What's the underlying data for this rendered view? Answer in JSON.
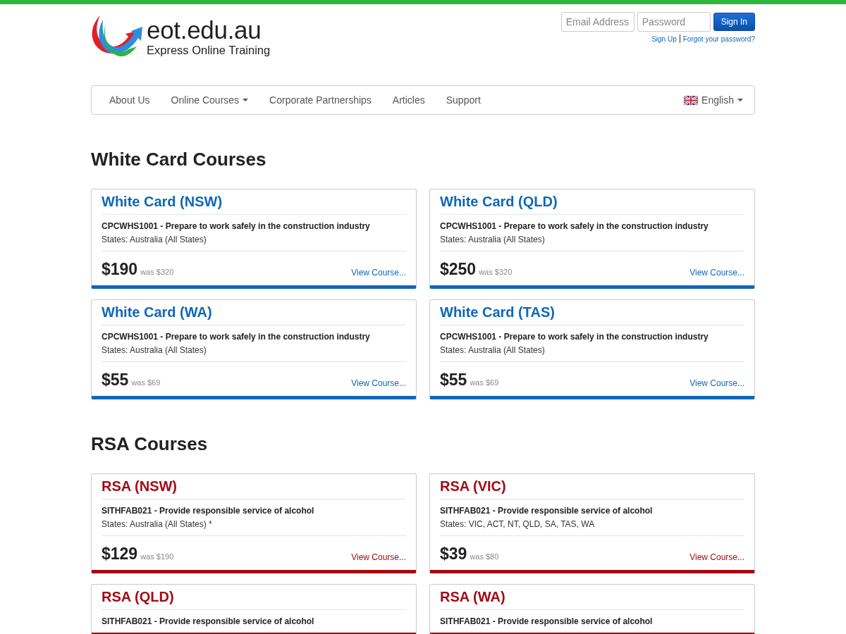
{
  "logo": {
    "name": "eot.edu.au",
    "tagline": "Express Online Training"
  },
  "login": {
    "email_placeholder": "Email Address",
    "password_placeholder": "Password",
    "button": "Sign In",
    "links": [
      "Sign Up",
      "Forgot your password?"
    ]
  },
  "nav": {
    "items": [
      {
        "label": "About Us",
        "dropdown": false
      },
      {
        "label": "Online Courses",
        "dropdown": true
      },
      {
        "label": "Corporate Partnerships",
        "dropdown": false
      },
      {
        "label": "Articles",
        "dropdown": false
      },
      {
        "label": "Support",
        "dropdown": false
      }
    ],
    "language": "English"
  },
  "sections": [
    {
      "title": "White Card Courses",
      "color": "#0f68b8",
      "courses": [
        {
          "title": "White Card (NSW)",
          "unit": "CPCWHS1001 - Prepare to work safely in the construction industry",
          "states": "States: Australia (All States)",
          "price": "$190",
          "was": "was $320",
          "link": "View Course..."
        },
        {
          "title": "White Card (QLD)",
          "unit": "CPCWHS1001 - Prepare to work safely in the construction industry",
          "states": "States: Australia (All States)",
          "price": "$250",
          "was": "was $320",
          "link": "View Course..."
        },
        {
          "title": "White Card (WA)",
          "unit": "CPCWHS1001 - Prepare to work safely in the construction industry",
          "states": "States: Australia (All States)",
          "price": "$55",
          "was": "was $69",
          "link": "View Course..."
        },
        {
          "title": "White Card (TAS)",
          "unit": "CPCWHS1001 - Prepare to work safely in the construction industry",
          "states": "States: Australia (All States)",
          "price": "$55",
          "was": "was $69",
          "link": "View Course..."
        }
      ]
    },
    {
      "title": "RSA Courses",
      "color": "#a30a14",
      "courses": [
        {
          "title": "RSA (NSW)",
          "unit": "SITHFAB021 - Provide responsible service of alcohol",
          "states": "States: Australia (All States) *",
          "price": "$129",
          "was": "was $190",
          "link": "View Course..."
        },
        {
          "title": "RSA (VIC)",
          "unit": "SITHFAB021 - Provide responsible service of alcohol",
          "states": "States: VIC, ACT, NT, QLD, SA, TAS, WA",
          "price": "$39",
          "was": "was $80",
          "link": "View Course..."
        },
        {
          "title": "RSA (QLD)",
          "unit": "SITHFAB021 - Provide responsible service of alcohol"
        },
        {
          "title": "RSA (WA)",
          "unit": "SITHFAB021 - Provide responsible service of alcohol"
        }
      ]
    }
  ]
}
